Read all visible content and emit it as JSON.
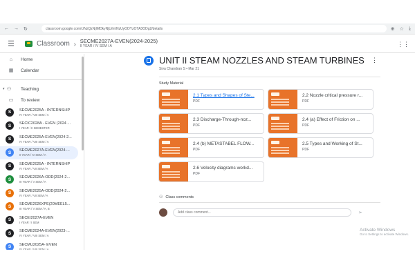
{
  "browser": {
    "url": "classroom.google.com/c/NzQzNjIMDkyNjU/m/NzUyODYzOTA3ODg2/details"
  },
  "header": {
    "brand": "Classroom",
    "course_title": "SECME2027A-EVEN(2024-2025)",
    "course_sub": "II YEAR / IV SEM / A"
  },
  "sidebar": {
    "home": "Home",
    "calendar": "Calendar",
    "teaching": "Teaching",
    "to_review": "To review",
    "classes": [
      {
        "letter": "S",
        "color": "#202124",
        "name": "SECME2025A - INTERNSHIP",
        "sub": "IV YEAR / VIII SEM / A"
      },
      {
        "letter": "S",
        "color": "#202124",
        "name": "SECIC2028A - EVEN (2024 ...",
        "sub": "I YEAR / II SEMESTER"
      },
      {
        "letter": "S",
        "color": "#202124",
        "name": "SECME2025A-EVEN(2024-2...",
        "sub": "IV YEAR / VIII SEM / A"
      },
      {
        "letter": "S",
        "color": "#4285f4",
        "name": "SECME2027A-EVEN(2024-...",
        "sub": "II YEAR / IV SEM / A"
      },
      {
        "letter": "S",
        "color": "#202124",
        "name": "SECME2025A - INTERNSHIP",
        "sub": "IV YEAR / VII SEM / A"
      },
      {
        "letter": "S",
        "color": "#1e8e3e",
        "name": "SECME2026A-ODD(2024-2...",
        "sub": "III YEAR / V SEM / A"
      },
      {
        "letter": "S",
        "color": "#e8710a",
        "name": "SECME2025A-ODD(2024-2...",
        "sub": "IV YEAR / VII SEM / A"
      },
      {
        "letter": "S",
        "color": "#e8710a",
        "name": "SECME2026XPE(20MEEL5...",
        "sub": "III YEAR / V SEM / A, B"
      },
      {
        "letter": "S",
        "color": "#202124",
        "name": "SECEI2027A-EVEN",
        "sub": "I YEAR / I SEM"
      },
      {
        "letter": "S",
        "color": "#202124",
        "name": "SECME2024A-EVEN(2023-...",
        "sub": "IV YEAR / VIII SEM / A"
      },
      {
        "letter": "S",
        "color": "#4285f4",
        "name": "SECMU2025A- EVEN",
        "sub": "IV YEAR / VIII SEM / A"
      }
    ]
  },
  "post": {
    "title": "UNIT II STEAM NOZZLES AND STEAM TURBINES",
    "author": "Siva Chandran S • Mar 21",
    "section": "Study Material",
    "materials": [
      {
        "title": "2.1 Types and Shapes of Ste...",
        "type": "PDF"
      },
      {
        "title": "2.2 Nozzle critical pressure r...",
        "type": "PDF"
      },
      {
        "title": "2.3 Discharge-Through-noz...",
        "type": "PDF"
      },
      {
        "title": "2.4 (a) Effect of Friction on ...",
        "type": "PDF"
      },
      {
        "title": "2.4 (b) METASTABEL FLOW...",
        "type": "PDF"
      },
      {
        "title": "2.5 Types and Working of St...",
        "type": "PDF"
      },
      {
        "title": "2.6 Velocity diagrams workd...",
        "type": "PDF"
      }
    ]
  },
  "comments": {
    "header": "Class comments",
    "placeholder": "Add class comment..."
  },
  "watermark": {
    "line1": "Activate Windows",
    "line2": "Go to Settings to activate Windows."
  }
}
